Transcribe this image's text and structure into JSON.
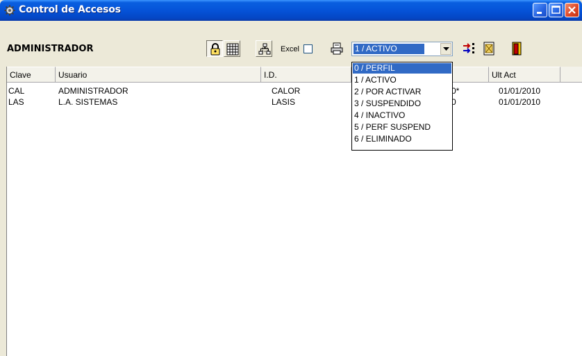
{
  "window": {
    "title": "Control de Accesos"
  },
  "toolbar": {
    "user_label": "ADMINISTRADOR",
    "excel_label": "Excel",
    "excel_checked": false,
    "status_selected": "1 / ACTIVO",
    "buttons": [
      "lock-button",
      "grid-button",
      "tree-button",
      "print-button",
      "transfer-button",
      "report-button",
      "exit-button"
    ]
  },
  "grid": {
    "columns": [
      "Clave",
      "Usuario",
      "I.D.",
      "",
      "Ult Act"
    ],
    "rows": [
      {
        "clave": "CAL",
        "usuario": "ADMINISTRADOR",
        "id": "CALOR",
        "partial": "0*",
        "ult_act": "01/01/2010"
      },
      {
        "clave": "LAS",
        "usuario": "L.A. SISTEMAS",
        "id": "LASIS",
        "partial": "0",
        "ult_act": "01/01/2010"
      }
    ]
  },
  "dropdown": {
    "options": [
      "0 / PERFIL",
      "1 / ACTIVO",
      "2 / POR ACTIVAR",
      "3 / SUSPENDIDO",
      "4 / INACTIVO",
      "5 / PERF SUSPEND",
      "6 / ELIMINADO"
    ],
    "highlighted_index": 0
  },
  "colors": {
    "titlebar": "#0553d8",
    "selection": "#316ac5",
    "face": "#ece9d8"
  }
}
